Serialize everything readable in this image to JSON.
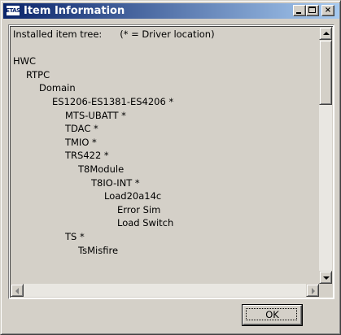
{
  "window": {
    "title": "Item Information",
    "icon_text": "ETAS",
    "icon_name": "etas-app-icon",
    "colors": {
      "titlebar_start": "#0a246a",
      "titlebar_end": "#a6caf0",
      "face": "#d4d0c8"
    }
  },
  "titlebar_buttons": {
    "minimize": "_",
    "maximize": "",
    "close": "×"
  },
  "tree": {
    "lines": [
      {
        "text": "Installed item tree:      (* = Driver location)",
        "level": 0
      },
      {
        "text": "",
        "level": 0
      },
      {
        "text": "HWC",
        "level": 0
      },
      {
        "text": "RTPC",
        "level": 1
      },
      {
        "text": "Domain",
        "level": 2
      },
      {
        "text": "ES1206-ES1381-ES4206 *",
        "level": 3
      },
      {
        "text": "MTS-UBATT *",
        "level": 4
      },
      {
        "text": "TDAC *",
        "level": 4
      },
      {
        "text": "TMIO *",
        "level": 4
      },
      {
        "text": "TRS422 *",
        "level": 4
      },
      {
        "text": "T8Module",
        "level": 5
      },
      {
        "text": "T8IO-INT *",
        "level": 6
      },
      {
        "text": "Load20a14c",
        "level": 7
      },
      {
        "text": "Error Sim",
        "level": 8
      },
      {
        "text": "Load Switch",
        "level": 8
      },
      {
        "text": "TS *",
        "level": 4
      },
      {
        "text": "TsMisfire",
        "level": 5
      }
    ]
  },
  "scrollbars": {
    "vertical_position": 0.0,
    "horizontal_position": 0.0
  },
  "buttons": {
    "ok_label": "OK"
  }
}
